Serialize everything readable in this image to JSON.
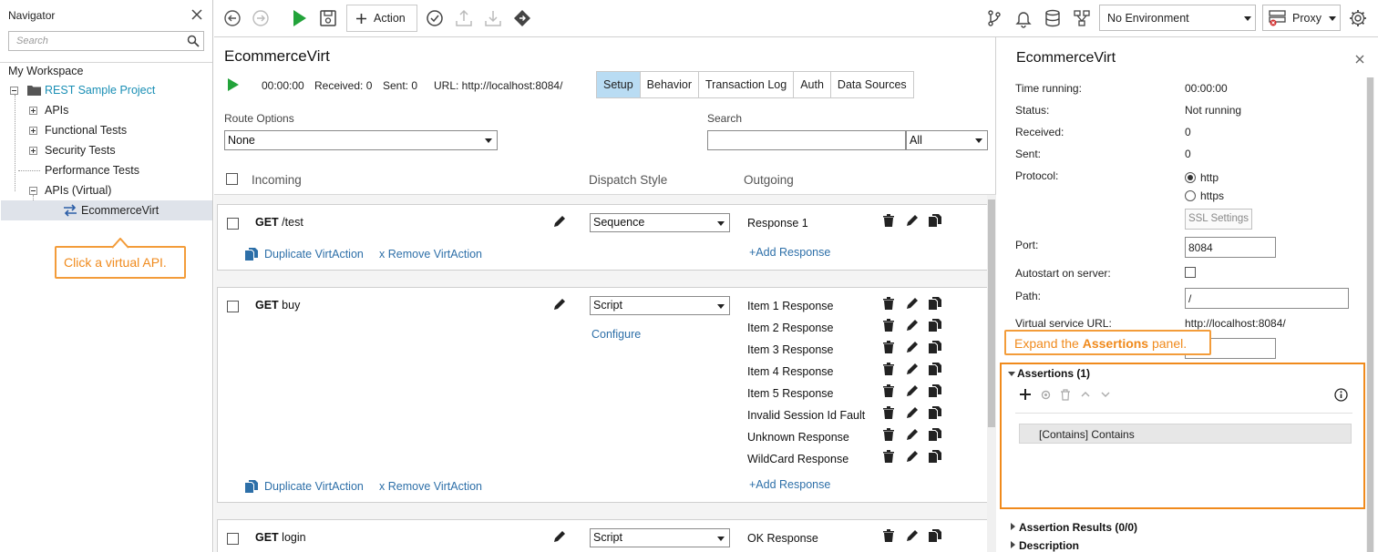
{
  "navigator": {
    "title": "Navigator",
    "search_placeholder": "Search",
    "workspace": "My Workspace",
    "tree": {
      "project": "REST Sample Project",
      "apis": "APIs",
      "functional_tests": "Functional Tests",
      "security_tests": "Security Tests",
      "performance_tests": "Performance Tests",
      "apis_virtual": "APIs (Virtual)",
      "virt_service": "EcommerceVirt"
    },
    "callout": "Click a virtual API."
  },
  "toolbar": {
    "action_label": "Action",
    "environment": "No Environment",
    "proxy": "Proxy"
  },
  "main": {
    "title": "EcommerceVirt",
    "time": "00:00:00",
    "received": "Received: 0",
    "sent": "Sent: 0",
    "url": "URL: http://localhost:8084/",
    "tabs": [
      "Setup",
      "Behavior",
      "Transaction Log",
      "Auth",
      "Data Sources"
    ],
    "route_options_label": "Route Options",
    "route_options_value": "None",
    "search_label": "Search",
    "search_scope": "All",
    "columns": {
      "incoming": "Incoming",
      "dispatch": "Dispatch Style",
      "outgoing": "Outgoing"
    },
    "duplicate_label": "Duplicate VirtAction",
    "remove_label": "x Remove VirtAction",
    "add_response_label": "+Add Response",
    "configure_label": "Configure",
    "actions": [
      {
        "method": "GET",
        "path": "/test",
        "dispatch": "Sequence",
        "responses": [
          "Response 1"
        ]
      },
      {
        "method": "GET",
        "path": "buy",
        "dispatch": "Script",
        "responses": [
          "Item 1 Response",
          "Item 2 Response",
          "Item 3 Response",
          "Item 4 Response",
          "Item 5 Response",
          "Invalid Session Id Fault",
          "Unknown Response",
          "WildCard Response"
        ]
      },
      {
        "method": "GET",
        "path": "login",
        "dispatch": "Script",
        "responses": [
          "OK Response"
        ]
      }
    ]
  },
  "right_panel": {
    "title": "EcommerceVirt",
    "props": {
      "time_running_k": "Time running:",
      "time_running_v": "00:00:00",
      "status_k": "Status:",
      "status_v": "Not running",
      "received_k": "Received:",
      "received_v": "0",
      "sent_k": "Sent:",
      "sent_v": "0",
      "protocol_k": "Protocol:",
      "protocol_http": "http",
      "protocol_https": "https",
      "ssl_settings": "SSL Settings",
      "port_k": "Port:",
      "port_v": "8084",
      "autostart_k": "Autostart on server:",
      "path_k": "Path:",
      "path_v": "/",
      "vurl_k": "Virtual service URL:",
      "vurl_v": "http://localhost:8084/"
    },
    "callout_prefix": "Expand the ",
    "callout_bold": "Assertions",
    "callout_suffix": " panel.",
    "assertions_title": "Assertions (1)",
    "assertion_item": "[Contains] Contains",
    "assertion_results": "Assertion Results (0/0)",
    "description": "Description"
  },
  "colors": {
    "accent_orange": "#f08a1c",
    "link_blue": "#2d6fa8",
    "tab_active": "#b9dcf3",
    "play_green": "#22a33a"
  }
}
